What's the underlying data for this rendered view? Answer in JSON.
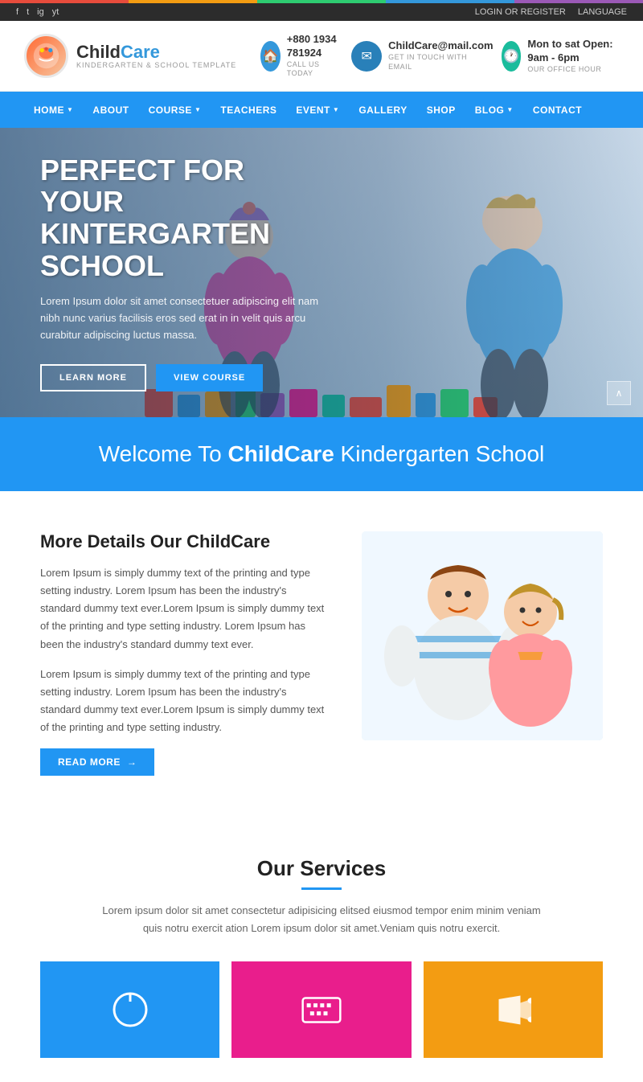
{
  "topbar": {
    "login_register": "LOGIN OR REGISTER",
    "language": "LANGUAGE",
    "social_icons": [
      "f",
      "t",
      "ig",
      "yt"
    ]
  },
  "header": {
    "logo_child": "Child",
    "logo_care": "Care",
    "logo_sub": "KINDERGARTEN & SCHOOL TEMPLATE",
    "phone": "+880 1934 781924",
    "phone_label": "CALL US TODAY",
    "email": "ChildCare@mail.com",
    "email_label": "GET IN TOUCH WITH EMAIL",
    "hours": "Mon to sat Open: 9am - 6pm",
    "hours_label": "OUR OFFICE HOUR"
  },
  "navbar": {
    "items": [
      {
        "label": "HOME",
        "has_dropdown": true
      },
      {
        "label": "ABOUT",
        "has_dropdown": false
      },
      {
        "label": "COURSE",
        "has_dropdown": true
      },
      {
        "label": "TEACHERS",
        "has_dropdown": false
      },
      {
        "label": "EVENT",
        "has_dropdown": true
      },
      {
        "label": "GALLERY",
        "has_dropdown": false
      },
      {
        "label": "SHOP",
        "has_dropdown": false
      },
      {
        "label": "BLOG",
        "has_dropdown": true
      },
      {
        "label": "CONTACT",
        "has_dropdown": false
      }
    ]
  },
  "hero": {
    "title": "PERFECT FOR YOUR KINTERGARTEN SCHOOL",
    "description": "Lorem Ipsum dolor sit amet consectetuer adipiscing elit nam nibh nunc varius facilisis eros sed erat in in velit quis arcu curabitur adipiscing luctus massa.",
    "btn_learn": "LEARN MORE",
    "btn_course": "VIEW COURSE"
  },
  "welcome": {
    "text_normal": "Welcome To ",
    "text_bold": "ChildCare",
    "text_end": " Kindergarten School"
  },
  "about": {
    "title": "More Details Our ChildCare",
    "text1": "Lorem Ipsum is simply dummy text of the printing and type setting industry. Lorem Ipsum has been the industry's standard dummy text ever.Lorem Ipsum is simply dummy text of the printing and type setting industry. Lorem Ipsum has been the industry's standard dummy text ever.",
    "text2": "Lorem Ipsum is simply dummy text of the printing and type setting industry. Lorem Ipsum has been the industry's standard dummy text ever.Lorem Ipsum is simply dummy text of the printing and type setting industry.",
    "btn_read_more": "READ MORE"
  },
  "services": {
    "title": "Our Services",
    "description": "Lorem ipsum dolor sit amet consectetur adipisicing elitsed eiusmod tempor enim minim veniam quis notru exercit ation Lorem ipsum dolor sit amet.Veniam quis notru exercit.",
    "cards": [
      {
        "icon": "⏻",
        "bg": "#2196F3"
      },
      {
        "icon": "⌨",
        "bg": "#e91e8c"
      },
      {
        "icon": "📣",
        "bg": "#f39c12"
      }
    ]
  }
}
